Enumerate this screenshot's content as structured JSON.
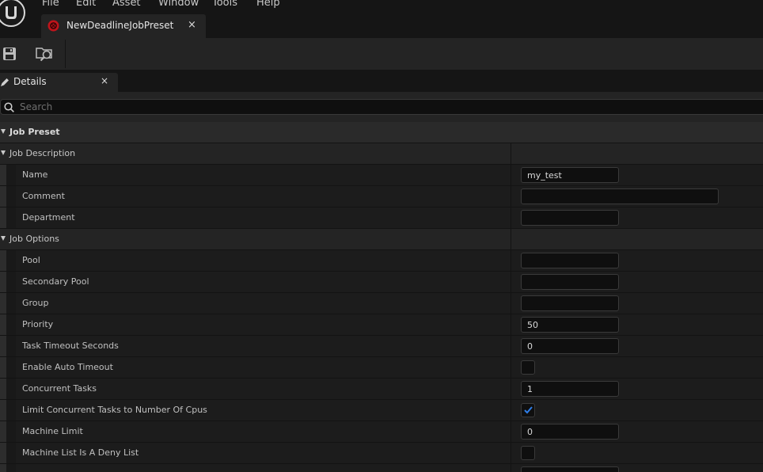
{
  "menu": {
    "items": [
      "File",
      "Edit",
      "Asset",
      "Window",
      "Tools",
      "Help"
    ]
  },
  "document_tab": {
    "title": "NewDeadlineJobPreset",
    "close_glyph": "×"
  },
  "toolbar": {
    "buttons": [
      "save-icon",
      "browse-icon"
    ]
  },
  "details_panel": {
    "tab_label": "Details",
    "close_glyph": "×",
    "search_placeholder": "Search"
  },
  "categories": {
    "job_preset": "Job Preset",
    "job_description": "Job Description",
    "job_options": "Job Options"
  },
  "properties": {
    "name": {
      "label": "Name",
      "value": "my_test"
    },
    "comment": {
      "label": "Comment",
      "value": ""
    },
    "department": {
      "label": "Department",
      "value": ""
    },
    "pool": {
      "label": "Pool",
      "value": ""
    },
    "secondary_pool": {
      "label": "Secondary Pool",
      "value": ""
    },
    "group": {
      "label": "Group",
      "value": ""
    },
    "priority": {
      "label": "Priority",
      "value": "50"
    },
    "task_timeout_seconds": {
      "label": "Task Timeout Seconds",
      "value": "0"
    },
    "enable_auto_timeout": {
      "label": "Enable Auto Timeout",
      "checked": false
    },
    "concurrent_tasks": {
      "label": "Concurrent Tasks",
      "value": "1"
    },
    "limit_concurrent_tasks": {
      "label": "Limit Concurrent Tasks to Number Of Cpus",
      "checked": true
    },
    "machine_limit": {
      "label": "Machine Limit",
      "value": "0"
    },
    "machine_list_deny": {
      "label": "Machine List Is A Deny List",
      "checked": false
    }
  },
  "colors": {
    "accent_blue": "#2f7ee8",
    "tab_icon_red": "#c0141b",
    "panel": "#242424",
    "background": "#151515"
  }
}
